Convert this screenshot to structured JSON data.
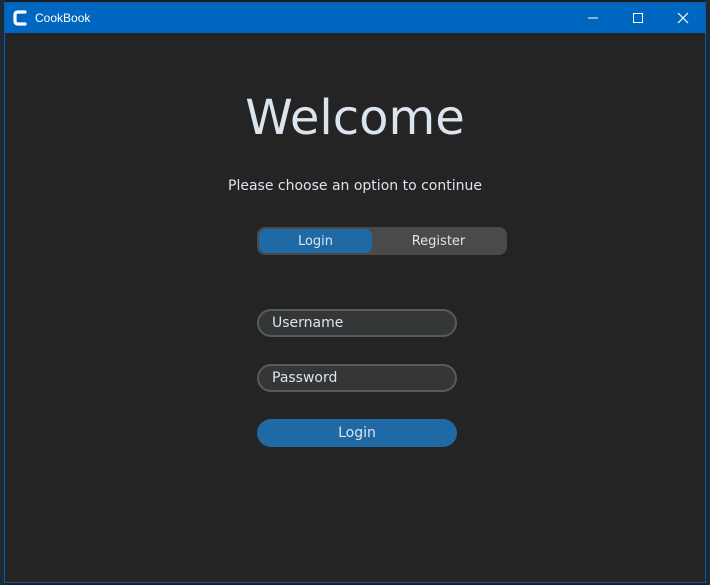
{
  "window": {
    "title": "CookBook",
    "accent": "#0067c0",
    "icon": "cookbook-app-icon",
    "controls": [
      "minimize-icon",
      "maximize-icon",
      "close-icon"
    ]
  },
  "main": {
    "heading": "Welcome",
    "subtitle": "Please choose an option to continue",
    "mode_switch": {
      "options": [
        "Login",
        "Register"
      ],
      "selected": "Login"
    },
    "form": {
      "username_placeholder": "Username",
      "password_placeholder": "Password",
      "submit_label": "Login"
    }
  },
  "colors": {
    "background": "#242424",
    "primary_button": "#1f6aa5",
    "input_bg": "#343638",
    "input_border": "#565b5e",
    "text": "#dce4ee"
  }
}
